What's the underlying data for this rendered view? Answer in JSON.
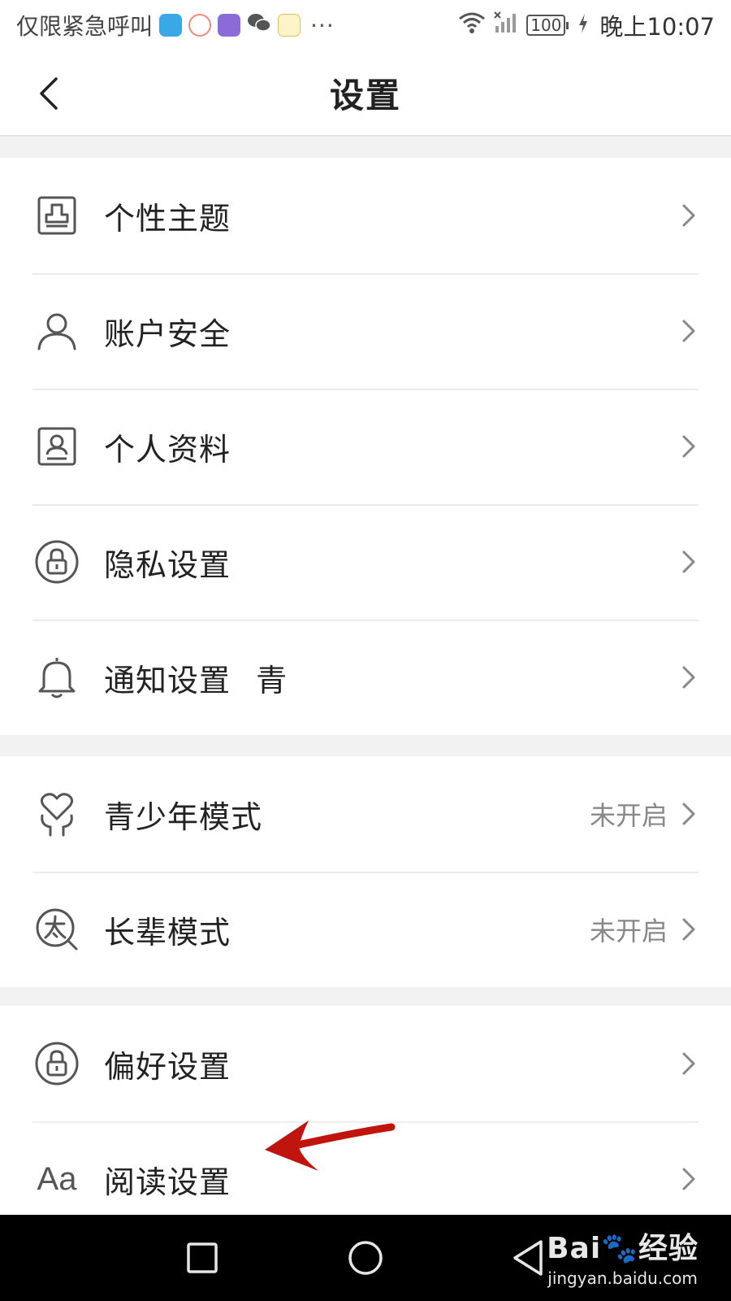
{
  "status_bar": {
    "carrier_text": "仅限紧急呼叫",
    "more": "···",
    "battery": "100",
    "time": "晚上10:07"
  },
  "header": {
    "title": "设置"
  },
  "groups": [
    {
      "items": [
        {
          "label": "个性主题",
          "icon": "theme-icon"
        },
        {
          "label": "账户安全",
          "icon": "person-icon"
        },
        {
          "label": "个人资料",
          "icon": "profile-card-icon"
        },
        {
          "label": "隐私设置",
          "icon": "lock-icon"
        },
        {
          "label": "通知设置",
          "icon": "bell-icon",
          "extra": "青"
        }
      ]
    },
    {
      "items": [
        {
          "label": "青少年模式",
          "icon": "youth-heart-icon",
          "value": "未开启"
        },
        {
          "label": "长辈模式",
          "icon": "elder-search-icon",
          "value": "未开启"
        }
      ]
    },
    {
      "items": [
        {
          "label": "偏好设置",
          "icon": "lock-icon"
        },
        {
          "label": "阅读设置",
          "icon": "font-aa-icon",
          "icon_text": "Aa"
        }
      ]
    }
  ],
  "watermark": {
    "brand": "Bai🐾经验",
    "url": "jingyan.baidu.com"
  },
  "colors": {
    "annotation_arrow": "#c0140f",
    "divider": "#ececec",
    "background": "#f2f2f2"
  }
}
